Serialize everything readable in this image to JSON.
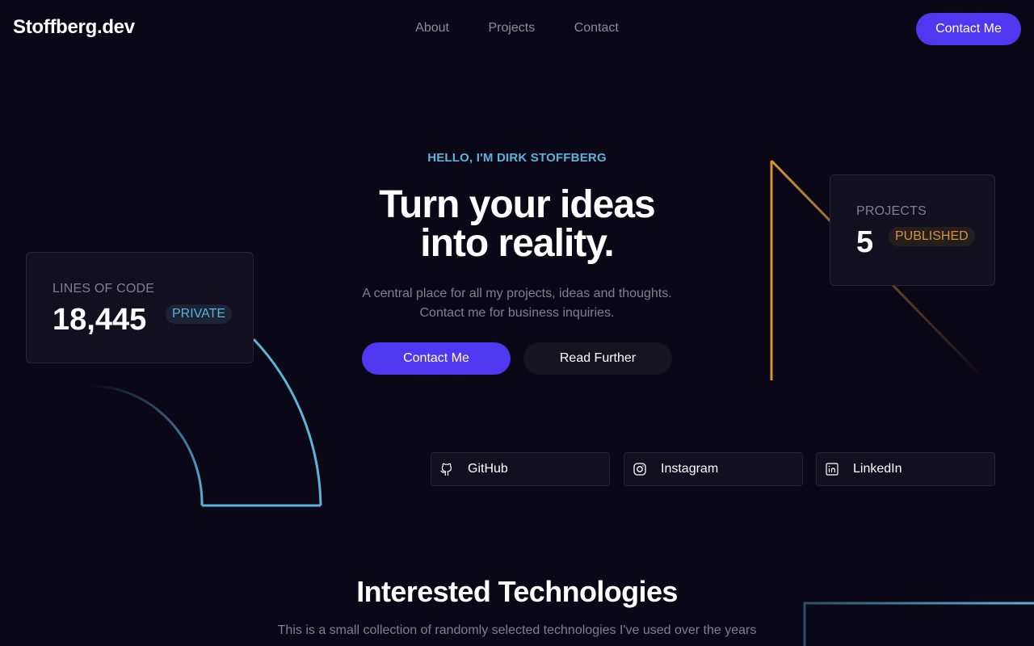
{
  "header": {
    "logo": "Stoffberg.dev",
    "nav": [
      "About",
      "Projects",
      "Contact"
    ],
    "cta_label": "Contact Me"
  },
  "hero": {
    "eyebrow": "HELLO, I'M DIRK STOFFBERG",
    "title_line1": "Turn your ideas",
    "title_line2": "into reality.",
    "subtitle_line1": "A central place for all my projects, ideas and thoughts.",
    "subtitle_line2": "Contact me for business inquiries.",
    "primary_button": "Contact Me",
    "secondary_button": "Read Further"
  },
  "stats": {
    "lines_of_code": {
      "label": "LINES OF CODE",
      "value": "18,445",
      "badge": "PRIVATE"
    },
    "projects": {
      "label": "PROJECTS",
      "value": "5",
      "badge": "PUBLISHED"
    }
  },
  "social": [
    {
      "label": "GitHub",
      "icon": "github-icon"
    },
    {
      "label": "Instagram",
      "icon": "instagram-icon"
    },
    {
      "label": "LinkedIn",
      "icon": "linkedin-icon"
    }
  ],
  "technologies": {
    "title": "Interested Technologies",
    "subtitle": "This is a small collection of randomly selected technologies I've used over the years"
  },
  "colors": {
    "background": "#0a0816",
    "accent": "#5037f0",
    "cyan": "#5db3db",
    "amber": "#d39437",
    "muted_text": "#807d98",
    "card": "#12101e"
  }
}
